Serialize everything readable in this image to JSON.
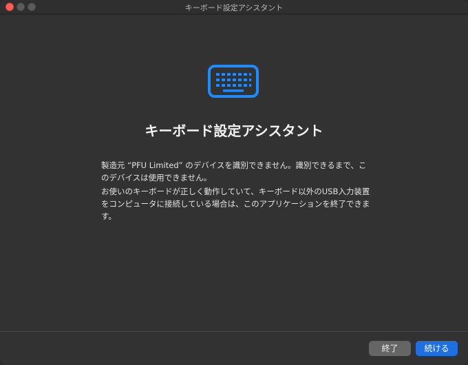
{
  "window": {
    "title": "キーボード設定アシスタント"
  },
  "main": {
    "icon": "keyboard-icon",
    "heading": "キーボード設定アシスタント",
    "paragraph1": "製造元 “PFU Limited” のデバイスを識別できません。識別できるまで、このデバイスは使用できません。",
    "paragraph2": "お使いのキーボードが正しく動作していて、キーボード以外のUSB入力装置をコンピュータに接続している場合は、このアプリケーションを終了できます。"
  },
  "footer": {
    "quit_label": "終了",
    "continue_label": "続ける"
  },
  "colors": {
    "accent": "#1f6fe0",
    "icon_blue": "#1e8cff",
    "background": "#323232"
  }
}
